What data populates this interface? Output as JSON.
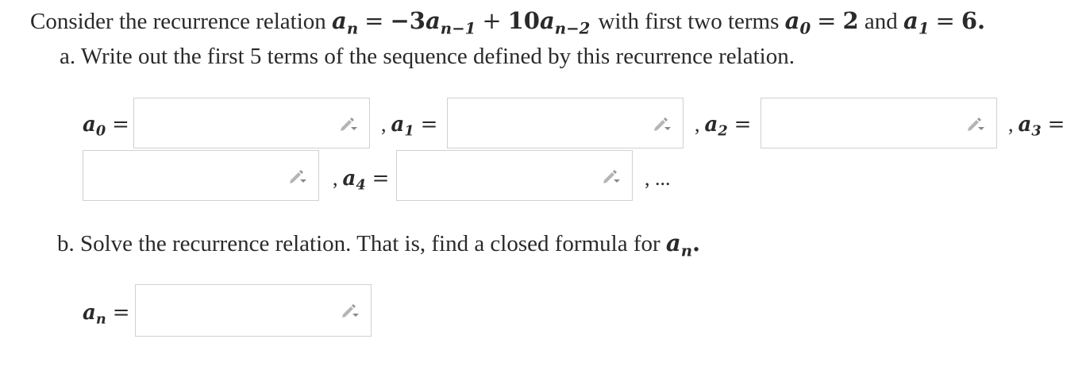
{
  "problem": {
    "intro_text": "Consider the recurrence relation",
    "relation": {
      "lhs_var": "a",
      "lhs_sub": "n",
      "eq": "=",
      "term1_coef": "−3",
      "term1_var": "a",
      "term1_sub": "n−1",
      "plus": "+",
      "term2_coef": "10",
      "term2_var": "a",
      "term2_sub": "n−2"
    },
    "with_text": "with first two terms",
    "a0_var": "a",
    "a0_sub": "0",
    "a0_eq": "=",
    "a0_val": "2",
    "and_text": "and",
    "a1_var": "a",
    "a1_sub": "1",
    "a1_eq": "=",
    "a1_val": "6",
    "period": "."
  },
  "part_a": {
    "prompt": "a. Write out the first 5 terms of the sequence defined by this recurrence relation.",
    "fields": [
      {
        "prefix": "",
        "var": "a",
        "sub": "0",
        "eq": "=",
        "value": ""
      },
      {
        "prefix": ",",
        "var": "a",
        "sub": "1",
        "eq": "=",
        "value": ""
      },
      {
        "prefix": ",",
        "var": "a",
        "sub": "2",
        "eq": "=",
        "value": ""
      },
      {
        "prefix": ",",
        "var": "a",
        "sub": "3",
        "eq": "=",
        "value": ""
      },
      {
        "prefix": ",",
        "var": "a",
        "sub": "4",
        "eq": "=",
        "value": ""
      }
    ],
    "trailing": ", ..."
  },
  "part_b": {
    "prompt_text": "b. Solve the recurrence relation. That is, find a closed formula for",
    "prompt_var": "a",
    "prompt_sub": "n",
    "prompt_period": ".",
    "field": {
      "var": "a",
      "sub": "n",
      "eq": "=",
      "value": ""
    }
  },
  "icons": {
    "edit": "pencil-dropdown-icon"
  },
  "colors": {
    "text": "#2a2a2a",
    "box_border": "#d0d0d0",
    "icon": "#9a9a9a"
  }
}
